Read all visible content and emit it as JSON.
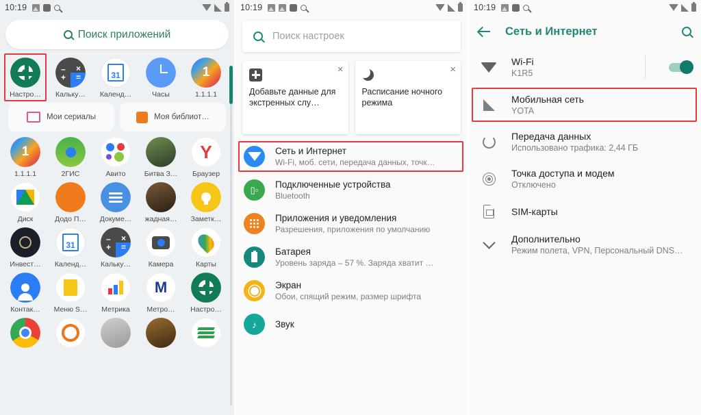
{
  "statusbar": {
    "time": "10:19",
    "icons_left": [
      "image-icon",
      "screenshot-icon",
      "square-icon",
      "search-icon"
    ],
    "icons_right": [
      "wifi-icon",
      "signal-icon",
      "battery-icon"
    ]
  },
  "launcher": {
    "search": {
      "label": "Поиск приложений",
      "icon": "search-icon"
    },
    "highlighted_app": "Настро…",
    "rows": [
      [
        {
          "name": "Настро…",
          "icon": "settings-gear-icon",
          "kind": "gear",
          "highlighted": true
        },
        {
          "name": "Кальку…",
          "icon": "calculator-icon",
          "kind": "calc"
        },
        {
          "name": "Календ…",
          "icon": "calendar-icon",
          "kind": "cal",
          "day": "31"
        },
        {
          "name": "Часы",
          "icon": "clock-icon",
          "kind": "clock"
        },
        {
          "name": "1.1.1.1",
          "icon": "one-one-icon",
          "kind": "onedot",
          "glyph": "1"
        }
      ],
      [
        {
          "name": "1.1.1.1",
          "icon": "one-one-icon",
          "kind": "onedot",
          "glyph": "1"
        },
        {
          "name": "2ГИС",
          "icon": "2gis-icon",
          "kind": "gis"
        },
        {
          "name": "Авито",
          "icon": "avito-icon",
          "kind": "avito"
        },
        {
          "name": "Битва З…",
          "icon": "game-icon",
          "kind": "game"
        },
        {
          "name": "Браузер",
          "icon": "yandex-browser-icon",
          "kind": "yabr",
          "glyph": "Y"
        }
      ],
      [
        {
          "name": "Диск",
          "icon": "google-drive-icon",
          "kind": "drive"
        },
        {
          "name": "Додо П…",
          "icon": "dodo-pizza-icon",
          "kind": "dodo"
        },
        {
          "name": "Докуме…",
          "icon": "google-docs-icon",
          "kind": "docs"
        },
        {
          "name": "жадная…",
          "icon": "game2-icon",
          "kind": "jadn"
        },
        {
          "name": "Заметк…",
          "icon": "notes-bulb-icon",
          "kind": "keep"
        }
      ],
      [
        {
          "name": "Инвест…",
          "icon": "investments-icon",
          "kind": "inv"
        },
        {
          "name": "Календ…",
          "icon": "calendar-icon",
          "kind": "cal",
          "day": "31"
        },
        {
          "name": "Кальку…",
          "icon": "calculator-icon",
          "kind": "calc"
        },
        {
          "name": "Камера",
          "icon": "camera-icon",
          "kind": "cam"
        },
        {
          "name": "Карты",
          "icon": "google-maps-icon",
          "kind": "maps"
        }
      ],
      [
        {
          "name": "Контак…",
          "icon": "contacts-icon",
          "kind": "cont"
        },
        {
          "name": "Меню S…",
          "icon": "sim-menu-icon",
          "kind": "menus"
        },
        {
          "name": "Метрика",
          "icon": "metrika-chart-icon",
          "kind": "metr"
        },
        {
          "name": "Метро…",
          "icon": "metro-icon",
          "kind": "metro",
          "glyph": "M"
        },
        {
          "name": "Настро…",
          "icon": "settings-gear-icon",
          "kind": "gear"
        }
      ],
      [
        {
          "name": "",
          "icon": "chrome-icon",
          "kind": "chrome"
        },
        {
          "name": "",
          "icon": "odnoklassniki-icon",
          "kind": "odkl"
        },
        {
          "name": "",
          "icon": "app-generic-icon",
          "kind": "gen1"
        },
        {
          "name": "",
          "icon": "app-generic2-icon",
          "kind": "gen2"
        },
        {
          "name": "",
          "icon": "sberbank-icon",
          "kind": "sber"
        }
      ]
    ],
    "widgets": [
      {
        "label": "Мои сериалы",
        "icon": "tv-play-icon"
      },
      {
        "label": "Моя библиот…",
        "icon": "music-library-icon"
      }
    ]
  },
  "settings": {
    "search": {
      "placeholder": "Поиск настроек",
      "icon": "search-icon"
    },
    "cards": [
      {
        "title": "Добавьте данные для экстренных слу…",
        "icon": "medical-cross-icon",
        "close": "×"
      },
      {
        "title": "Расписание ночного режима",
        "icon": "moon-icon",
        "close": "×"
      }
    ],
    "items": [
      {
        "title": "Сеть и Интернет",
        "subtitle": "Wi-Fi, моб. сети, передача данных, точк…",
        "icon": "wifi-icon",
        "color": "#2a8cf0",
        "highlighted": true
      },
      {
        "title": "Подключенные устройства",
        "subtitle": "Bluetooth",
        "icon": "bluetooth-devices-icon",
        "color": "#3aa84f",
        "highlighted": false
      },
      {
        "title": "Приложения и уведомления",
        "subtitle": "Разрешения, приложения по умолчанию",
        "icon": "apps-grid-icon",
        "color": "#ef8220",
        "highlighted": false
      },
      {
        "title": "Батарея",
        "subtitle": "Уровень заряда – 57 %. Заряда хватит …",
        "icon": "battery-icon",
        "color": "#16897c",
        "highlighted": false
      },
      {
        "title": "Экран",
        "subtitle": "Обои, спящий режим, размер шрифта",
        "icon": "display-brightness-icon",
        "color": "#f5b216",
        "highlighted": false
      },
      {
        "title": "Звук",
        "subtitle": "",
        "icon": "sound-icon",
        "color": "#16a79b",
        "highlighted": false
      }
    ]
  },
  "network": {
    "appbar": {
      "title": "Сеть и Интернет",
      "back_icon": "arrow-back-icon",
      "search_icon": "search-icon"
    },
    "items": [
      {
        "title": "Wi-Fi",
        "subtitle": "K1R5",
        "icon": "wifi-icon",
        "has_switch": true,
        "switch_on": true,
        "highlighted": false
      },
      {
        "title": "Мобильная сеть",
        "subtitle": "YOTA",
        "icon": "signal-bars-icon",
        "has_switch": false,
        "highlighted": true
      },
      {
        "title": "Передача данных",
        "subtitle": "Использовано трафика: 2,44 ГБ",
        "icon": "data-usage-ring-icon",
        "has_switch": false,
        "highlighted": false
      },
      {
        "title": "Точка доступа и модем",
        "subtitle": "Отключено",
        "icon": "hotspot-icon",
        "has_switch": false,
        "highlighted": false
      },
      {
        "title": "SIM-карты",
        "subtitle": "",
        "icon": "sim-card-icon",
        "has_switch": false,
        "highlighted": false
      },
      {
        "title": "Дополнительно",
        "subtitle": "Режим полета, VPN, Персональный DNS…",
        "icon": "chevron-down-icon",
        "has_switch": false,
        "highlighted": false
      }
    ]
  },
  "colors": {
    "accent_green": "#1f8a70",
    "highlight_red": "#e8393c",
    "toggle_on": "#13796a"
  }
}
